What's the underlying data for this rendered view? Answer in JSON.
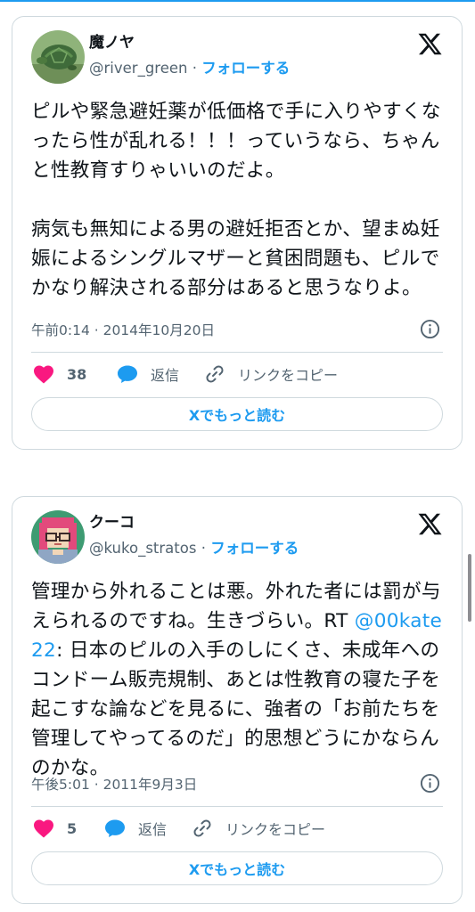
{
  "colors": {
    "accent": "#1d9bf0",
    "like": "#f91880",
    "muted": "#536471",
    "border": "#cfd9de"
  },
  "tweets": [
    {
      "name": "魔ノヤ",
      "handle": "@river_green",
      "sep": "·",
      "follow_label": "フォローする",
      "text": "ピルや緊急避妊薬が低価格で手に入りやすくなったら性が乱れる！！！っていうなら、ちゃんと性教育すりゃいいのだよ。\n\n病気も無知による男の避妊拒否とか、望まぬ妊娠によるシングルマザーと貧困問題も、ピルでかなり解決される部分はあると思うなりよ。",
      "timestamp": "午前0:14 · 2014年10月20日",
      "likes": "38",
      "reply_label": "返信",
      "copy_link_label": "リンクをコピー",
      "read_more_label": "Xでもっと読む",
      "icons": [
        "x-logo-icon",
        "info-icon",
        "heart-icon",
        "reply-bubble-icon",
        "link-icon"
      ]
    },
    {
      "name": "クーコ",
      "handle": "@kuko_stratos",
      "sep": "·",
      "follow_label": "フォローする",
      "text_before": "管理から外れることは悪。外れた者には罰が与えられるのですね。生きづらい。RT ",
      "mention": "@00kate22",
      "text_after": ": 日本のピルの入手のしにくさ、未成年へのコンドーム販売規制、あとは性教育の寝た子を起こすな論などを見るに、強者の「お前たちを管理してやってるのだ」的思想どうにかならんのかな。",
      "timestamp": "午後5:01 · 2011年9月3日",
      "likes": "5",
      "reply_label": "返信",
      "copy_link_label": "リンクをコピー",
      "read_more_label": "Xでもっと読む",
      "icons": [
        "x-logo-icon",
        "info-icon",
        "heart-icon",
        "reply-bubble-icon",
        "link-icon"
      ]
    }
  ]
}
